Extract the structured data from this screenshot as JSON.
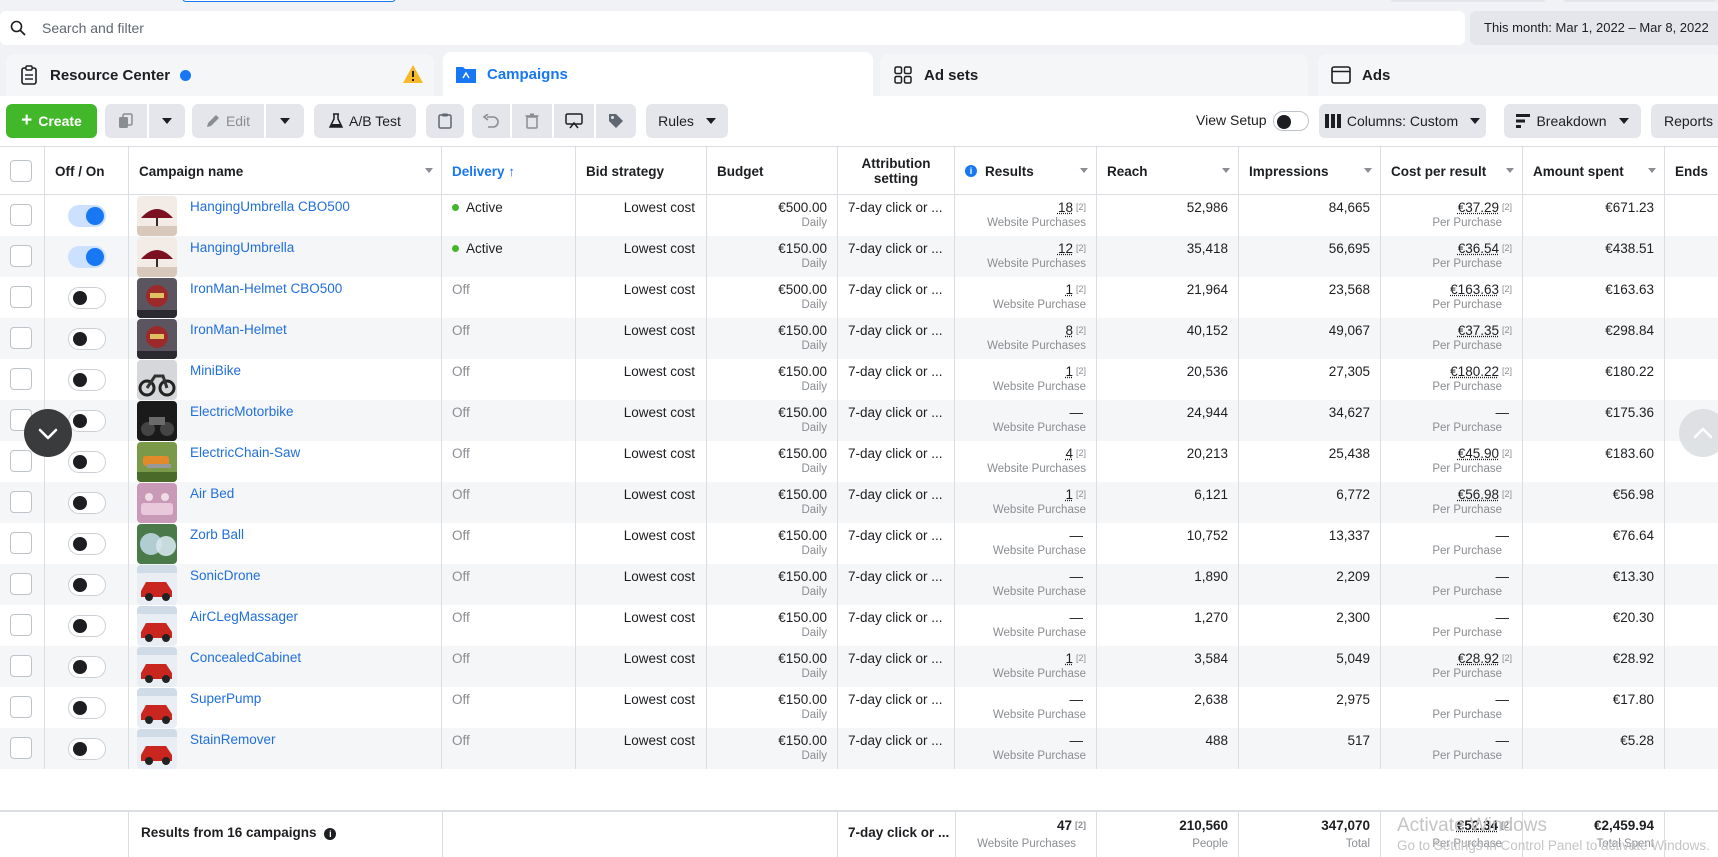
{
  "search": {
    "placeholder": "Search and filter"
  },
  "date_range": "This month: Mar 1, 2022 – Mar 8, 2022",
  "tabs": [
    {
      "label": "Resource Center"
    },
    {
      "label": "Campaigns"
    },
    {
      "label": "Ad sets"
    },
    {
      "label": "Ads"
    }
  ],
  "toolbar": {
    "create": "Create",
    "edit": "Edit",
    "ab_test": "A/B Test",
    "rules": "Rules",
    "view_setup": "View Setup",
    "columns": "Columns: Custom",
    "breakdown": "Breakdown",
    "reports": "Reports"
  },
  "columns": {
    "off_on": "Off / On",
    "campaign_name": "Campaign name",
    "delivery": "Delivery ↑",
    "bid_strategy": "Bid strategy",
    "budget": "Budget",
    "attribution_line1": "Attribution",
    "attribution_line2": "setting",
    "results": "Results",
    "reach": "Reach",
    "impressions": "Impressions",
    "cost_per_result": "Cost per result",
    "amount_spent": "Amount spent",
    "ends": "Ends"
  },
  "campaigns": [
    {
      "name": "HangingUmbrella CBO500",
      "on": true,
      "delivery": "Active",
      "bid": "Lowest cost",
      "budget": "€500.00",
      "budget_sub": "Daily",
      "attribution": "7-day click or ...",
      "results": "18",
      "results_fn": "[2]",
      "results_sub": "Website Purchases",
      "reach": "52,986",
      "impressions": "84,665",
      "cpr": "€37.29",
      "cpr_fn": "[2]",
      "cpr_sub": "Per Purchase",
      "spent": "€671.23",
      "thumb": "umbrella"
    },
    {
      "name": "HangingUmbrella",
      "on": true,
      "delivery": "Active",
      "bid": "Lowest cost",
      "budget": "€150.00",
      "budget_sub": "Daily",
      "attribution": "7-day click or ...",
      "results": "12",
      "results_fn": "[2]",
      "results_sub": "Website Purchases",
      "reach": "35,418",
      "impressions": "56,695",
      "cpr": "€36.54",
      "cpr_fn": "[2]",
      "cpr_sub": "Per Purchase",
      "spent": "€438.51",
      "thumb": "umbrella"
    },
    {
      "name": "IronMan-Helmet CBO500",
      "on": false,
      "delivery": "Off",
      "bid": "Lowest cost",
      "budget": "€500.00",
      "budget_sub": "Daily",
      "attribution": "7-day click or ...",
      "results": "1",
      "results_fn": "[2]",
      "results_sub": "Website Purchase",
      "reach": "21,964",
      "impressions": "23,568",
      "cpr": "€163.63",
      "cpr_fn": "[2]",
      "cpr_sub": "Per Purchase",
      "spent": "€163.63",
      "thumb": "helmet"
    },
    {
      "name": "IronMan-Helmet",
      "on": false,
      "delivery": "Off",
      "bid": "Lowest cost",
      "budget": "€150.00",
      "budget_sub": "Daily",
      "attribution": "7-day click or ...",
      "results": "8",
      "results_fn": "[2]",
      "results_sub": "Website Purchases",
      "reach": "40,152",
      "impressions": "49,067",
      "cpr": "€37.35",
      "cpr_fn": "[2]",
      "cpr_sub": "Per Purchase",
      "spent": "€298.84",
      "thumb": "helmet"
    },
    {
      "name": "MiniBike",
      "on": false,
      "delivery": "Off",
      "bid": "Lowest cost",
      "budget": "€150.00",
      "budget_sub": "Daily",
      "attribution": "7-day click or ...",
      "results": "1",
      "results_fn": "[2]",
      "results_sub": "Website Purchase",
      "reach": "20,536",
      "impressions": "27,305",
      "cpr": "€180.22",
      "cpr_fn": "[2]",
      "cpr_sub": "Per Purchase",
      "spent": "€180.22",
      "thumb": "bike"
    },
    {
      "name": "ElectricMotorbike",
      "on": false,
      "delivery": "Off",
      "bid": "Lowest cost",
      "budget": "€150.00",
      "budget_sub": "Daily",
      "attribution": "7-day click or ...",
      "results": "—",
      "results_fn": "",
      "results_sub": "Website Purchase",
      "reach": "24,944",
      "impressions": "34,627",
      "cpr": "—",
      "cpr_fn": "",
      "cpr_sub": "Per Purchase",
      "spent": "€175.36",
      "thumb": "motorbike"
    },
    {
      "name": "ElectricChain-Saw",
      "on": false,
      "delivery": "Off",
      "bid": "Lowest cost",
      "budget": "€150.00",
      "budget_sub": "Daily",
      "attribution": "7-day click or ...",
      "results": "4",
      "results_fn": "[2]",
      "results_sub": "Website Purchases",
      "reach": "20,213",
      "impressions": "25,438",
      "cpr": "€45.90",
      "cpr_fn": "[2]",
      "cpr_sub": "Per Purchase",
      "spent": "€183.60",
      "thumb": "saw"
    },
    {
      "name": "Air Bed",
      "on": false,
      "delivery": "Off",
      "bid": "Lowest cost",
      "budget": "€150.00",
      "budget_sub": "Daily",
      "attribution": "7-day click or ...",
      "results": "1",
      "results_fn": "[2]",
      "results_sub": "Website Purchase",
      "reach": "6,121",
      "impressions": "6,772",
      "cpr": "€56.98",
      "cpr_fn": "[2]",
      "cpr_sub": "Per Purchase",
      "spent": "€56.98",
      "thumb": "bed"
    },
    {
      "name": "Zorb Ball",
      "on": false,
      "delivery": "Off",
      "bid": "Lowest cost",
      "budget": "€150.00",
      "budget_sub": "Daily",
      "attribution": "7-day click or ...",
      "results": "—",
      "results_fn": "",
      "results_sub": "Website Purchase",
      "reach": "10,752",
      "impressions": "13,337",
      "cpr": "—",
      "cpr_fn": "",
      "cpr_sub": "Per Purchase",
      "spent": "€76.64",
      "thumb": "zorb"
    },
    {
      "name": "SonicDrone",
      "on": false,
      "delivery": "Off",
      "bid": "Lowest cost",
      "budget": "€150.00",
      "budget_sub": "Daily",
      "attribution": "7-day click or ...",
      "results": "—",
      "results_fn": "",
      "results_sub": "Website Purchase",
      "reach": "1,890",
      "impressions": "2,209",
      "cpr": "—",
      "cpr_fn": "",
      "cpr_sub": "Per Purchase",
      "spent": "€13.30",
      "thumb": "car"
    },
    {
      "name": "AirCLegMassager",
      "on": false,
      "delivery": "Off",
      "bid": "Lowest cost",
      "budget": "€150.00",
      "budget_sub": "Daily",
      "attribution": "7-day click or ...",
      "results": "—",
      "results_fn": "",
      "results_sub": "Website Purchase",
      "reach": "1,270",
      "impressions": "2,300",
      "cpr": "—",
      "cpr_fn": "",
      "cpr_sub": "Per Purchase",
      "spent": "€20.30",
      "thumb": "car"
    },
    {
      "name": "ConcealedCabinet",
      "on": false,
      "delivery": "Off",
      "bid": "Lowest cost",
      "budget": "€150.00",
      "budget_sub": "Daily",
      "attribution": "7-day click or ...",
      "results": "1",
      "results_fn": "[2]",
      "results_sub": "Website Purchase",
      "reach": "3,584",
      "impressions": "5,049",
      "cpr": "€28.92",
      "cpr_fn": "[2]",
      "cpr_sub": "Per Purchase",
      "spent": "€28.92",
      "thumb": "car"
    },
    {
      "name": "SuperPump",
      "on": false,
      "delivery": "Off",
      "bid": "Lowest cost",
      "budget": "€150.00",
      "budget_sub": "Daily",
      "attribution": "7-day click or ...",
      "results": "—",
      "results_fn": "",
      "results_sub": "Website Purchase",
      "reach": "2,638",
      "impressions": "2,975",
      "cpr": "—",
      "cpr_fn": "",
      "cpr_sub": "Per Purchase",
      "spent": "€17.80",
      "thumb": "car"
    },
    {
      "name": "StainRemover",
      "on": false,
      "delivery": "Off",
      "bid": "Lowest cost",
      "budget": "€150.00",
      "budget_sub": "Daily",
      "attribution": "7-day click or ...",
      "results": "—",
      "results_fn": "",
      "results_sub": "Website Purchase",
      "reach": "488",
      "impressions": "517",
      "cpr": "—",
      "cpr_fn": "",
      "cpr_sub": "Per Purchase",
      "spent": "€5.28",
      "thumb": "car"
    }
  ],
  "footer": {
    "label": "Results from 16 campaigns",
    "attribution": "7-day click or ...",
    "results": "47",
    "results_fn": "[2]",
    "results_sub": "Website Purchases",
    "reach": "210,560",
    "reach_sub": "People",
    "impressions": "347,070",
    "impressions_sub": "Total",
    "cpr": "€52.34",
    "cpr_fn": "[2]",
    "cpr_sub": "Per Purchase",
    "spent": "€2,459.94",
    "spent_sub": "Total Spent"
  },
  "watermark": {
    "line1": "Activate Windows",
    "line2": "Go to Settings in Control Panel to activate Windows."
  },
  "colors": {
    "accent": "#1877f2",
    "create": "#42b72a",
    "link": "#216fdb",
    "warning": "#f7b928"
  }
}
